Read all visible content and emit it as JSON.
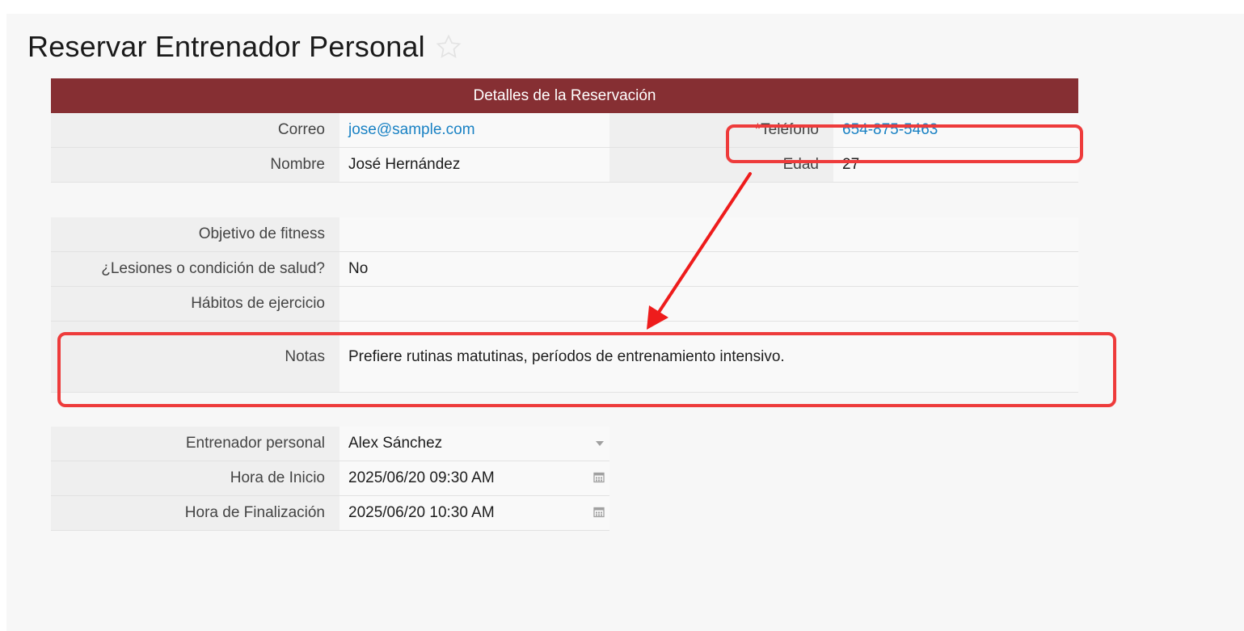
{
  "page": {
    "title": "Reservar Entrenador Personal"
  },
  "section": {
    "header": "Detalles de la Reservación"
  },
  "contact": {
    "email_label": "Correo",
    "email_value": "jose@sample.com",
    "phone_required_marker": "*",
    "phone_label": "Teléfono",
    "phone_value": "654-875-5463",
    "name_label": "Nombre",
    "name_value": "José Hernández",
    "age_label": "Edad",
    "age_value": "27"
  },
  "fitness": {
    "goal_label": "Objetivo de fitness",
    "goal_value": "",
    "injuries_label": "¿Lesiones o condición de salud?",
    "injuries_value": "No",
    "habits_label": "Hábitos de ejercicio",
    "habits_value": "",
    "notes_label": "Notas",
    "notes_value": "Prefiere rutinas matutinas, períodos de entrenamiento intensivo."
  },
  "booking": {
    "trainer_label": "Entrenador personal",
    "trainer_value": "Alex Sánchez",
    "start_label": "Hora de Inicio",
    "start_value": "2025/06/20 09:30 AM",
    "end_label": "Hora de Finalización",
    "end_value": "2025/06/20 10:30 AM"
  },
  "icons": {
    "favorite": "star-outline-icon",
    "dropdown": "caret-down-icon",
    "calendar": "calendar-icon"
  },
  "colors": {
    "header_bg": "#862f33",
    "link": "#1a82c4",
    "required": "#d32f2f",
    "annotation": "#ee3b3b"
  }
}
